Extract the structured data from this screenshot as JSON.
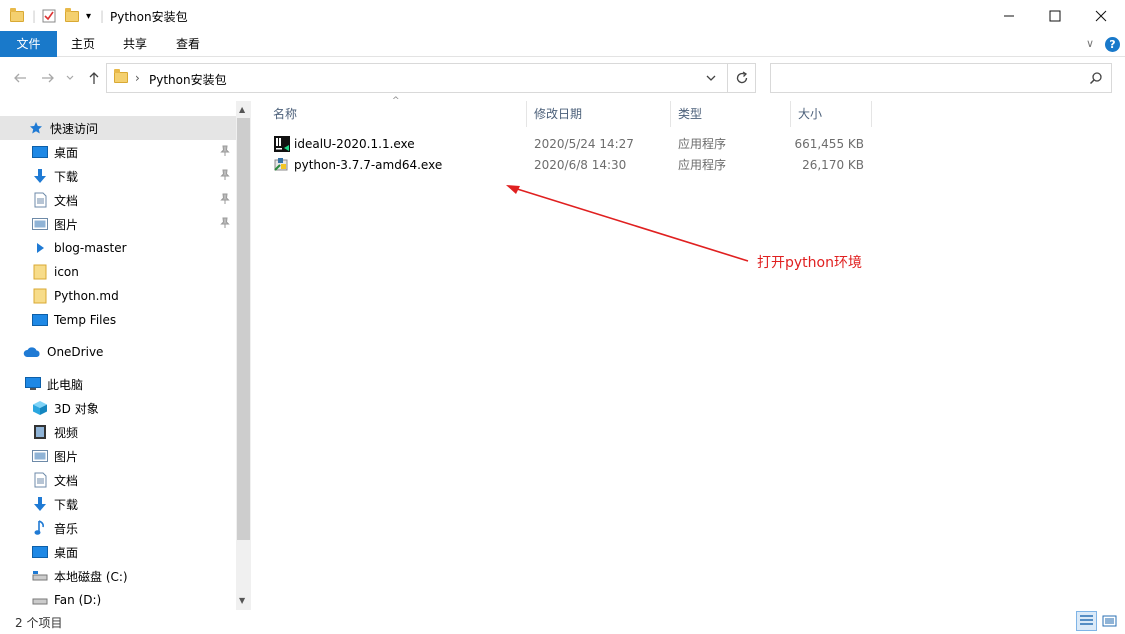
{
  "window": {
    "title": "Python安装包",
    "minimize_glyph": "—",
    "maximize_glyph": "☐",
    "close_glyph": "✕"
  },
  "ribbon": {
    "tabs": [
      {
        "label": "文件",
        "active": true
      },
      {
        "label": "主页",
        "active": false
      },
      {
        "label": "共享",
        "active": false
      },
      {
        "label": "查看",
        "active": false
      }
    ]
  },
  "address": {
    "path_segment": "Python安装包",
    "search_placeholder": ""
  },
  "sidebar": {
    "items": [
      {
        "label": "快速访问",
        "icon": "star-icon",
        "pinned": false,
        "selected": true
      },
      {
        "label": "桌面",
        "icon": "desktop-icon",
        "pinned": true,
        "selected": false
      },
      {
        "label": "下载",
        "icon": "download-icon",
        "pinned": true,
        "selected": false
      },
      {
        "label": "文档",
        "icon": "document-icon",
        "pinned": true,
        "selected": false
      },
      {
        "label": "图片",
        "icon": "pictures-icon",
        "pinned": true,
        "selected": false
      },
      {
        "label": "blog-master",
        "icon": "play-folder-icon",
        "pinned": false,
        "selected": false
      },
      {
        "label": "icon",
        "icon": "folder-icon",
        "pinned": false,
        "selected": false
      },
      {
        "label": "Python.md",
        "icon": "folder-icon",
        "pinned": false,
        "selected": false
      },
      {
        "label": "Temp Files",
        "icon": "desktop-icon",
        "pinned": false,
        "selected": false
      },
      {
        "label": "OneDrive",
        "icon": "cloud-icon",
        "pinned": false,
        "selected": false
      },
      {
        "label": "此电脑",
        "icon": "computer-icon",
        "pinned": false,
        "selected": false
      },
      {
        "label": "3D 对象",
        "icon": "cube-icon",
        "pinned": false,
        "selected": false
      },
      {
        "label": "视频",
        "icon": "video-icon",
        "pinned": false,
        "selected": false
      },
      {
        "label": "图片",
        "icon": "pictures-icon",
        "pinned": false,
        "selected": false
      },
      {
        "label": "文档",
        "icon": "document-icon",
        "pinned": false,
        "selected": false
      },
      {
        "label": "下载",
        "icon": "download-icon",
        "pinned": false,
        "selected": false
      },
      {
        "label": "音乐",
        "icon": "music-icon",
        "pinned": false,
        "selected": false
      },
      {
        "label": "桌面",
        "icon": "desktop-icon",
        "pinned": false,
        "selected": false
      },
      {
        "label": "本地磁盘 (C:)",
        "icon": "drive-icon",
        "pinned": false,
        "selected": false
      },
      {
        "label": "Fan (D:)",
        "icon": "drive-icon",
        "pinned": false,
        "selected": false
      }
    ]
  },
  "columns": {
    "name": "名称",
    "modified": "修改日期",
    "type": "类型",
    "size": "大小"
  },
  "files": [
    {
      "name": "idealU-2020.1.1.exe",
      "modified": "2020/5/24 14:27",
      "type": "应用程序",
      "size": "661,455 KB",
      "icon": "intellij-icon"
    },
    {
      "name": "python-3.7.7-amd64.exe",
      "modified": "2020/6/8 14:30",
      "type": "应用程序",
      "size": "26,170 KB",
      "icon": "python-installer-icon"
    }
  ],
  "annotation": {
    "text": "打开python环境",
    "color": "#e02020"
  },
  "status": {
    "item_count": "2 个项目"
  },
  "colors": {
    "accent": "#1979ca",
    "selected_nav": "#e5e5e5",
    "annotation": "#e02020"
  }
}
